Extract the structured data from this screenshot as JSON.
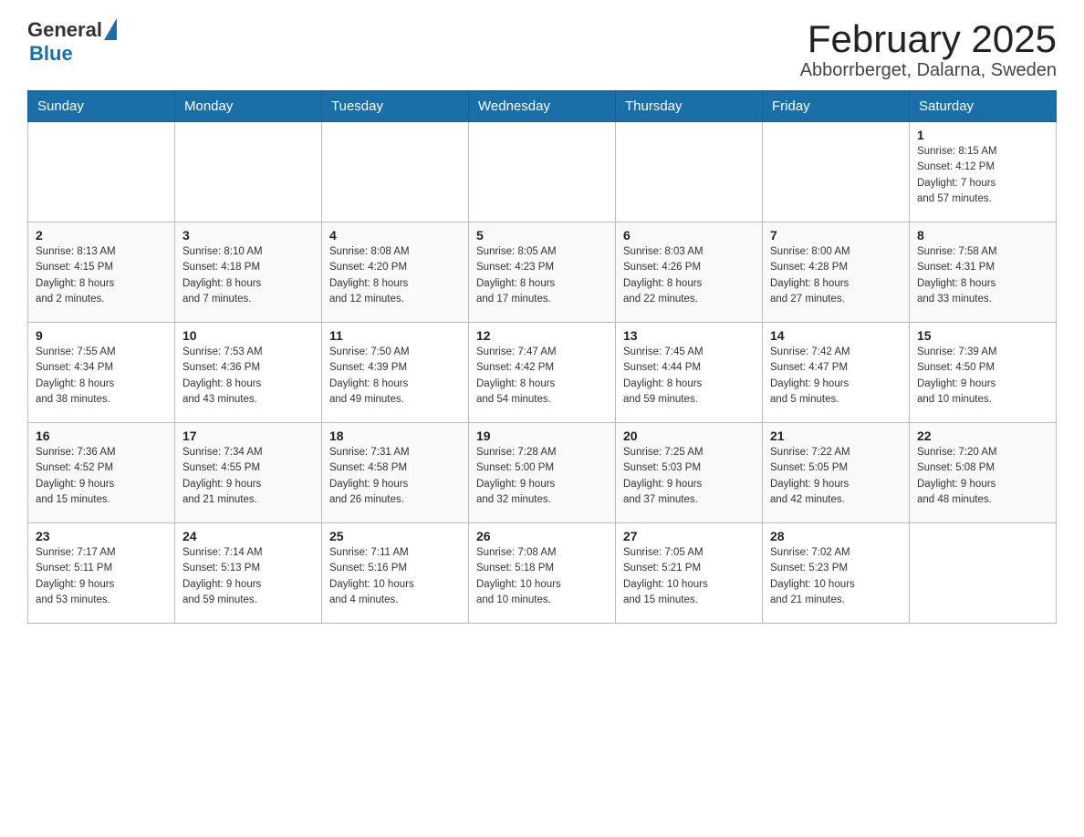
{
  "header": {
    "logo": {
      "general": "General",
      "blue": "Blue"
    },
    "title": "February 2025",
    "subtitle": "Abborrberget, Dalarna, Sweden"
  },
  "weekdays": [
    "Sunday",
    "Monday",
    "Tuesday",
    "Wednesday",
    "Thursday",
    "Friday",
    "Saturday"
  ],
  "weeks": [
    [
      {
        "day": "",
        "info": ""
      },
      {
        "day": "",
        "info": ""
      },
      {
        "day": "",
        "info": ""
      },
      {
        "day": "",
        "info": ""
      },
      {
        "day": "",
        "info": ""
      },
      {
        "day": "",
        "info": ""
      },
      {
        "day": "1",
        "info": "Sunrise: 8:15 AM\nSunset: 4:12 PM\nDaylight: 7 hours\nand 57 minutes."
      }
    ],
    [
      {
        "day": "2",
        "info": "Sunrise: 8:13 AM\nSunset: 4:15 PM\nDaylight: 8 hours\nand 2 minutes."
      },
      {
        "day": "3",
        "info": "Sunrise: 8:10 AM\nSunset: 4:18 PM\nDaylight: 8 hours\nand 7 minutes."
      },
      {
        "day": "4",
        "info": "Sunrise: 8:08 AM\nSunset: 4:20 PM\nDaylight: 8 hours\nand 12 minutes."
      },
      {
        "day": "5",
        "info": "Sunrise: 8:05 AM\nSunset: 4:23 PM\nDaylight: 8 hours\nand 17 minutes."
      },
      {
        "day": "6",
        "info": "Sunrise: 8:03 AM\nSunset: 4:26 PM\nDaylight: 8 hours\nand 22 minutes."
      },
      {
        "day": "7",
        "info": "Sunrise: 8:00 AM\nSunset: 4:28 PM\nDaylight: 8 hours\nand 27 minutes."
      },
      {
        "day": "8",
        "info": "Sunrise: 7:58 AM\nSunset: 4:31 PM\nDaylight: 8 hours\nand 33 minutes."
      }
    ],
    [
      {
        "day": "9",
        "info": "Sunrise: 7:55 AM\nSunset: 4:34 PM\nDaylight: 8 hours\nand 38 minutes."
      },
      {
        "day": "10",
        "info": "Sunrise: 7:53 AM\nSunset: 4:36 PM\nDaylight: 8 hours\nand 43 minutes."
      },
      {
        "day": "11",
        "info": "Sunrise: 7:50 AM\nSunset: 4:39 PM\nDaylight: 8 hours\nand 49 minutes."
      },
      {
        "day": "12",
        "info": "Sunrise: 7:47 AM\nSunset: 4:42 PM\nDaylight: 8 hours\nand 54 minutes."
      },
      {
        "day": "13",
        "info": "Sunrise: 7:45 AM\nSunset: 4:44 PM\nDaylight: 8 hours\nand 59 minutes."
      },
      {
        "day": "14",
        "info": "Sunrise: 7:42 AM\nSunset: 4:47 PM\nDaylight: 9 hours\nand 5 minutes."
      },
      {
        "day": "15",
        "info": "Sunrise: 7:39 AM\nSunset: 4:50 PM\nDaylight: 9 hours\nand 10 minutes."
      }
    ],
    [
      {
        "day": "16",
        "info": "Sunrise: 7:36 AM\nSunset: 4:52 PM\nDaylight: 9 hours\nand 15 minutes."
      },
      {
        "day": "17",
        "info": "Sunrise: 7:34 AM\nSunset: 4:55 PM\nDaylight: 9 hours\nand 21 minutes."
      },
      {
        "day": "18",
        "info": "Sunrise: 7:31 AM\nSunset: 4:58 PM\nDaylight: 9 hours\nand 26 minutes."
      },
      {
        "day": "19",
        "info": "Sunrise: 7:28 AM\nSunset: 5:00 PM\nDaylight: 9 hours\nand 32 minutes."
      },
      {
        "day": "20",
        "info": "Sunrise: 7:25 AM\nSunset: 5:03 PM\nDaylight: 9 hours\nand 37 minutes."
      },
      {
        "day": "21",
        "info": "Sunrise: 7:22 AM\nSunset: 5:05 PM\nDaylight: 9 hours\nand 42 minutes."
      },
      {
        "day": "22",
        "info": "Sunrise: 7:20 AM\nSunset: 5:08 PM\nDaylight: 9 hours\nand 48 minutes."
      }
    ],
    [
      {
        "day": "23",
        "info": "Sunrise: 7:17 AM\nSunset: 5:11 PM\nDaylight: 9 hours\nand 53 minutes."
      },
      {
        "day": "24",
        "info": "Sunrise: 7:14 AM\nSunset: 5:13 PM\nDaylight: 9 hours\nand 59 minutes."
      },
      {
        "day": "25",
        "info": "Sunrise: 7:11 AM\nSunset: 5:16 PM\nDaylight: 10 hours\nand 4 minutes."
      },
      {
        "day": "26",
        "info": "Sunrise: 7:08 AM\nSunset: 5:18 PM\nDaylight: 10 hours\nand 10 minutes."
      },
      {
        "day": "27",
        "info": "Sunrise: 7:05 AM\nSunset: 5:21 PM\nDaylight: 10 hours\nand 15 minutes."
      },
      {
        "day": "28",
        "info": "Sunrise: 7:02 AM\nSunset: 5:23 PM\nDaylight: 10 hours\nand 21 minutes."
      },
      {
        "day": "",
        "info": ""
      }
    ]
  ]
}
